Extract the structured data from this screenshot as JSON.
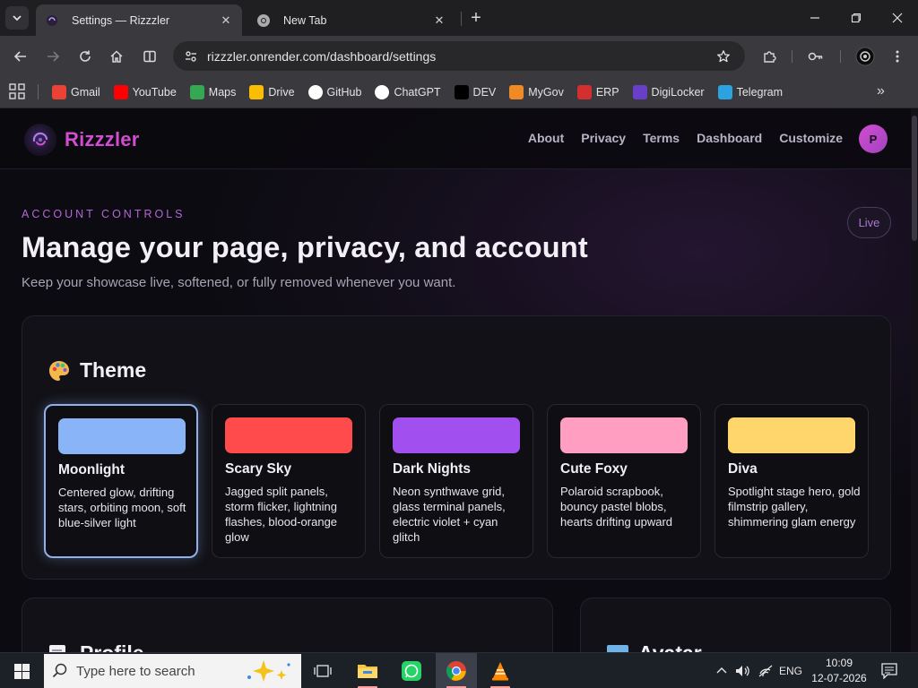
{
  "browser": {
    "tabs": [
      {
        "title": "Settings — Rizzzler",
        "active": true
      },
      {
        "title": "New Tab",
        "active": false
      }
    ],
    "url": "rizzzler.onrender.com/dashboard/settings",
    "bookmarks": [
      {
        "label": "Gmail",
        "icon": "gmail-icon",
        "color": "#ea4335"
      },
      {
        "label": "YouTube",
        "icon": "youtube-icon",
        "color": "#ff0000"
      },
      {
        "label": "Maps",
        "icon": "maps-icon",
        "color": "#34a853"
      },
      {
        "label": "Drive",
        "icon": "drive-icon",
        "color": "#fbbc04"
      },
      {
        "label": "GitHub",
        "icon": "github-icon",
        "color": "#ffffff"
      },
      {
        "label": "ChatGPT",
        "icon": "chatgpt-icon",
        "color": "#ffffff"
      },
      {
        "label": "DEV",
        "icon": "dev-icon",
        "color": "#000000"
      },
      {
        "label": "MyGov",
        "icon": "mygov-icon",
        "color": "#f08a24"
      },
      {
        "label": "ERP",
        "icon": "erp-icon",
        "color": "#d32f2f"
      },
      {
        "label": "DigiLocker",
        "icon": "digilocker-icon",
        "color": "#6a3fc8"
      },
      {
        "label": "Telegram",
        "icon": "telegram-icon",
        "color": "#2aa3e0"
      }
    ]
  },
  "site": {
    "brand": "Rizzzler",
    "nav": [
      "About",
      "Privacy",
      "Terms",
      "Dashboard",
      "Customize"
    ],
    "avatar_initial": "P",
    "accent": "#d24cd0"
  },
  "header": {
    "eyebrow": "ACCOUNT CONTROLS",
    "title": "Manage your page, privacy, and account",
    "subtitle": "Keep your showcase live, softened, or fully removed whenever you want.",
    "status": "Live"
  },
  "theme": {
    "title": "Theme",
    "selected": "Moonlight",
    "options": [
      {
        "name": "Moonlight",
        "desc": "Centered glow, drifting stars, orbiting moon, soft blue-silver light",
        "color": "#8ab4f8"
      },
      {
        "name": "Scary Sky",
        "desc": "Jagged split panels, storm flicker, lightning flashes, blood-orange glow",
        "color": "#ff4b4b"
      },
      {
        "name": "Dark Nights",
        "desc": "Neon synthwave grid, glass terminal panels, electric violet + cyan glitch",
        "color": "#a24ff0"
      },
      {
        "name": "Cute Foxy",
        "desc": "Polaroid scrapbook, bouncy pastel blobs, hearts drifting upward",
        "color": "#ff9ec0"
      },
      {
        "name": "Diva",
        "desc": "Spotlight stage hero, gold filmstrip gallery, shimmering glam energy",
        "color": "#ffd66b"
      }
    ]
  },
  "sections": {
    "profile": "Profile",
    "avatar": "Avatar"
  },
  "taskbar": {
    "search_placeholder": "Type here to search",
    "language": "ENG",
    "time": "10:09",
    "date": "12-07-2026"
  }
}
